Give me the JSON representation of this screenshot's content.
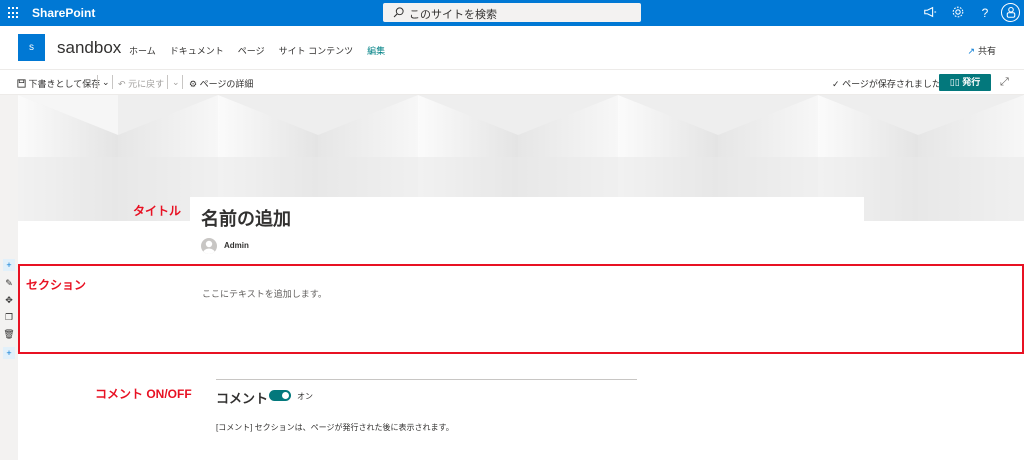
{
  "suitebar": {
    "brand": "SharePoint",
    "search_placeholder": "このサイトを検索",
    "help": "?",
    "colors": {
      "bar": "#0078d4"
    }
  },
  "site": {
    "logo_letter": "s",
    "name": "sandbox",
    "nav": [
      "ホーム",
      "ドキュメント",
      "ページ",
      "サイト コンテンツ",
      "編集"
    ],
    "share": "共有"
  },
  "commandbar": {
    "save_draft": "下書きとして保存",
    "undo": "元に戻す",
    "page_details": "ページの詳細",
    "saved_status": "ページが保存されました",
    "publish": "発行",
    "colors": {
      "publish": "#03787c"
    }
  },
  "page": {
    "title": "名前の追加",
    "author": "Admin",
    "section_placeholder": "ここにテキストを追加します。"
  },
  "annotations": {
    "title": "タイトル",
    "section": "セクション",
    "comments": "コメント ON/OFF",
    "color": "#e81123"
  },
  "comments": {
    "label": "コメント",
    "toggle_state": "オン",
    "note": "[コメント] セクションは、ページが発行された後に表示されます。"
  }
}
